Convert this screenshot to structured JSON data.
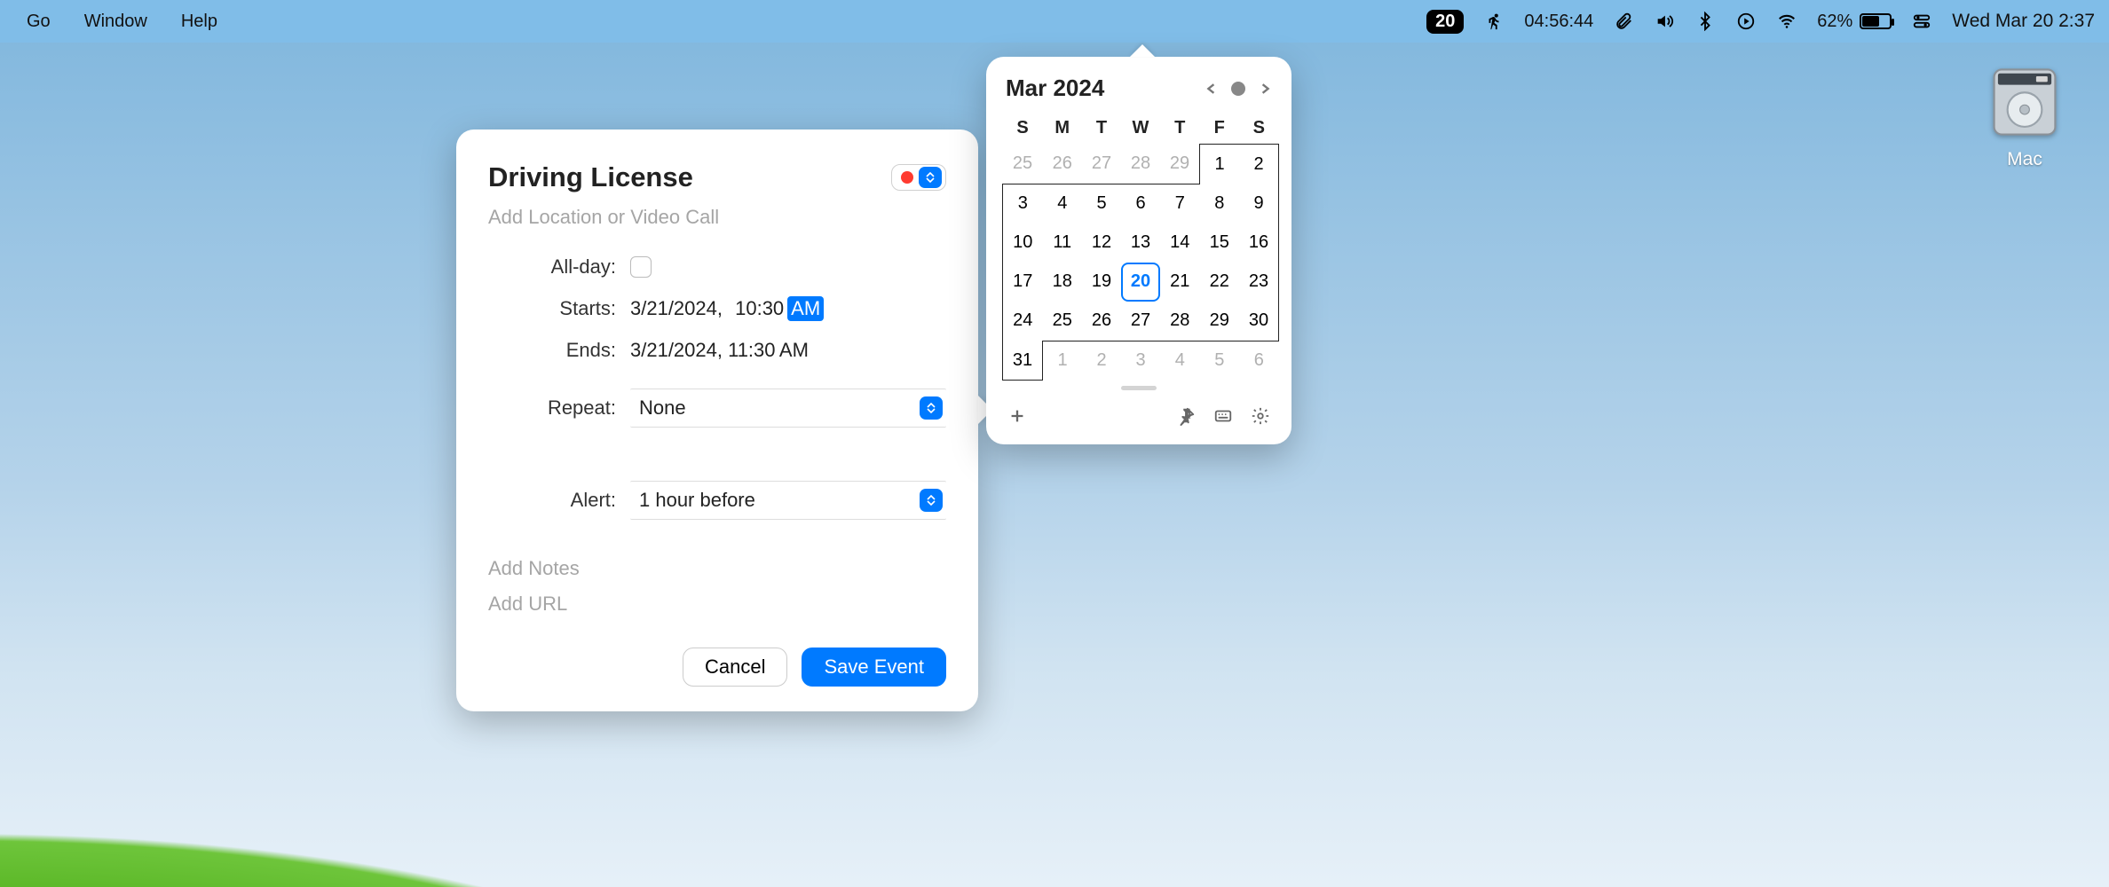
{
  "menubar": {
    "items": [
      "Go",
      "Window",
      "Help"
    ],
    "date_badge": "20",
    "uptime": "04:56:44",
    "battery_percent": "62%",
    "clock": "Wed Mar 20  2:37"
  },
  "desktop": {
    "drive_label": "Mac"
  },
  "event": {
    "title": "Driving License",
    "location_placeholder": "Add Location or Video Call",
    "allday_label": "All-day:",
    "starts_label": "Starts:",
    "starts_value_date": "3/21/2024,",
    "starts_value_time": "10:30",
    "starts_value_ampm": "AM",
    "ends_label": "Ends:",
    "ends_value": "3/21/2024, 11:30 AM",
    "repeat_label": "Repeat:",
    "repeat_value": "None",
    "alert_label": "Alert:",
    "alert_value": "1 hour before",
    "notes_placeholder": "Add Notes",
    "url_placeholder": "Add URL",
    "cancel_label": "Cancel",
    "save_label": "Save Event",
    "calendar_color": "#ff3b30"
  },
  "calendar": {
    "title": "Mar 2024",
    "weekdays": [
      "S",
      "M",
      "T",
      "W",
      "T",
      "F",
      "S"
    ],
    "today": 20,
    "weeks": [
      [
        {
          "n": 25,
          "o": true
        },
        {
          "n": 26,
          "o": true
        },
        {
          "n": 27,
          "o": true
        },
        {
          "n": 28,
          "o": true
        },
        {
          "n": 29,
          "o": true
        },
        {
          "n": 1
        },
        {
          "n": 2
        }
      ],
      [
        {
          "n": 3
        },
        {
          "n": 4
        },
        {
          "n": 5
        },
        {
          "n": 6
        },
        {
          "n": 7
        },
        {
          "n": 8
        },
        {
          "n": 9
        }
      ],
      [
        {
          "n": 10
        },
        {
          "n": 11
        },
        {
          "n": 12
        },
        {
          "n": 13
        },
        {
          "n": 14
        },
        {
          "n": 15
        },
        {
          "n": 16
        }
      ],
      [
        {
          "n": 17
        },
        {
          "n": 18
        },
        {
          "n": 19
        },
        {
          "n": 20
        },
        {
          "n": 21
        },
        {
          "n": 22
        },
        {
          "n": 23
        }
      ],
      [
        {
          "n": 24
        },
        {
          "n": 25
        },
        {
          "n": 26
        },
        {
          "n": 27
        },
        {
          "n": 28
        },
        {
          "n": 29
        },
        {
          "n": 30
        }
      ],
      [
        {
          "n": 31
        },
        {
          "n": 1,
          "o": true
        },
        {
          "n": 2,
          "o": true
        },
        {
          "n": 3,
          "o": true
        },
        {
          "n": 4,
          "o": true
        },
        {
          "n": 5,
          "o": true
        },
        {
          "n": 6,
          "o": true
        }
      ]
    ]
  }
}
